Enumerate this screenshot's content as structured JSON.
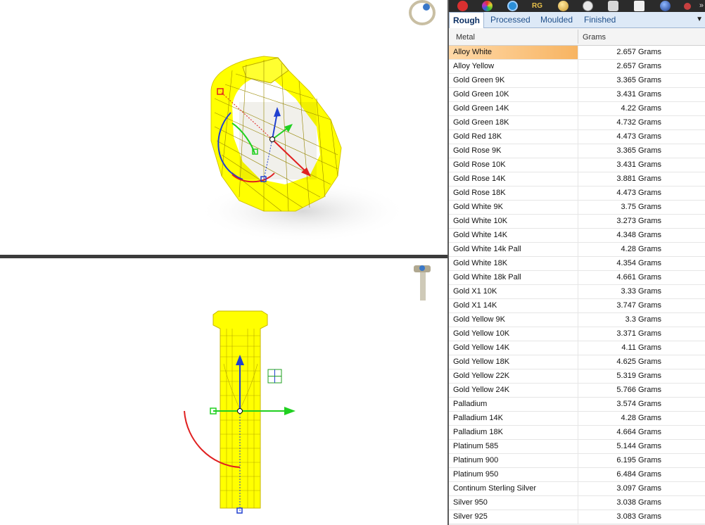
{
  "panel": {
    "tabs": [
      {
        "label": "Rough",
        "active": true
      },
      {
        "label": "Processed",
        "active": false
      },
      {
        "label": "Moulded",
        "active": false
      },
      {
        "label": "Finished",
        "active": false
      }
    ],
    "toolbar": {
      "rg_label": "RG",
      "more_label": "»",
      "icons": [
        "heart-icon",
        "color-wheel-icon",
        "ring-gear-icon",
        "rg-icon",
        "gold-sphere-icon",
        "compass-icon",
        "mug-icon",
        "cube-icon",
        "sphere-icon",
        "tool-icon"
      ]
    },
    "columns": {
      "metal": "Metal",
      "grams": "Grams"
    },
    "rows": [
      {
        "metal": "Alloy White",
        "grams": "2.657 Grams"
      },
      {
        "metal": "Alloy Yellow",
        "grams": "2.657 Grams"
      },
      {
        "metal": "Gold Green 9K",
        "grams": "3.365 Grams"
      },
      {
        "metal": "Gold Green 10K",
        "grams": "3.431 Grams"
      },
      {
        "metal": "Gold Green 14K",
        "grams": "4.22 Grams"
      },
      {
        "metal": "Gold Green 18K",
        "grams": "4.732 Grams"
      },
      {
        "metal": "Gold Red 18K",
        "grams": "4.473 Grams"
      },
      {
        "metal": "Gold Rose 9K",
        "grams": "3.365 Grams"
      },
      {
        "metal": "Gold Rose 10K",
        "grams": "3.431 Grams"
      },
      {
        "metal": "Gold Rose 14K",
        "grams": "3.881 Grams"
      },
      {
        "metal": "Gold Rose 18K",
        "grams": "4.473 Grams"
      },
      {
        "metal": "Gold White 9K",
        "grams": "3.75 Grams"
      },
      {
        "metal": "Gold White 10K",
        "grams": "3.273 Grams"
      },
      {
        "metal": "Gold White 14K",
        "grams": "4.348 Grams"
      },
      {
        "metal": "Gold White 14k Pall",
        "grams": "4.28 Grams"
      },
      {
        "metal": "Gold White 18K",
        "grams": "4.354 Grams"
      },
      {
        "metal": "Gold White 18k Pall",
        "grams": "4.661 Grams"
      },
      {
        "metal": "Gold X1 10K",
        "grams": "3.33 Grams"
      },
      {
        "metal": "Gold X1 14K",
        "grams": "3.747 Grams"
      },
      {
        "metal": "Gold Yellow 9K",
        "grams": "3.3 Grams"
      },
      {
        "metal": "Gold Yellow 10K",
        "grams": "3.371 Grams"
      },
      {
        "metal": "Gold Yellow 14K",
        "grams": "4.11 Grams"
      },
      {
        "metal": "Gold Yellow 18K",
        "grams": "4.625 Grams"
      },
      {
        "metal": "Gold Yellow 22K",
        "grams": "5.319 Grams"
      },
      {
        "metal": "Gold Yellow 24K",
        "grams": "5.766 Grams"
      },
      {
        "metal": "Palladium",
        "grams": "3.574 Grams"
      },
      {
        "metal": "Palladium 14K",
        "grams": "4.28 Grams"
      },
      {
        "metal": "Palladium 18K",
        "grams": "4.664 Grams"
      },
      {
        "metal": "Platinum 585",
        "grams": "5.144 Grams"
      },
      {
        "metal": "Platinum 900",
        "grams": "6.195 Grams"
      },
      {
        "metal": "Platinum 950",
        "grams": "6.484 Grams"
      },
      {
        "metal": "Continum Sterling Silver",
        "grams": "3.097 Grams"
      },
      {
        "metal": "Silver 950",
        "grams": "3.038 Grams"
      },
      {
        "metal": "Silver 925",
        "grams": "3.083 Grams"
      }
    ],
    "selected_row": "Alloy White"
  },
  "colors": {
    "wireframe": "#ffff00",
    "gumball_x": "#e02020",
    "gumball_y": "#20d020",
    "gumball_z": "#2040d0",
    "tab_bg": "#dde9f7",
    "selection": "#f7b462"
  }
}
